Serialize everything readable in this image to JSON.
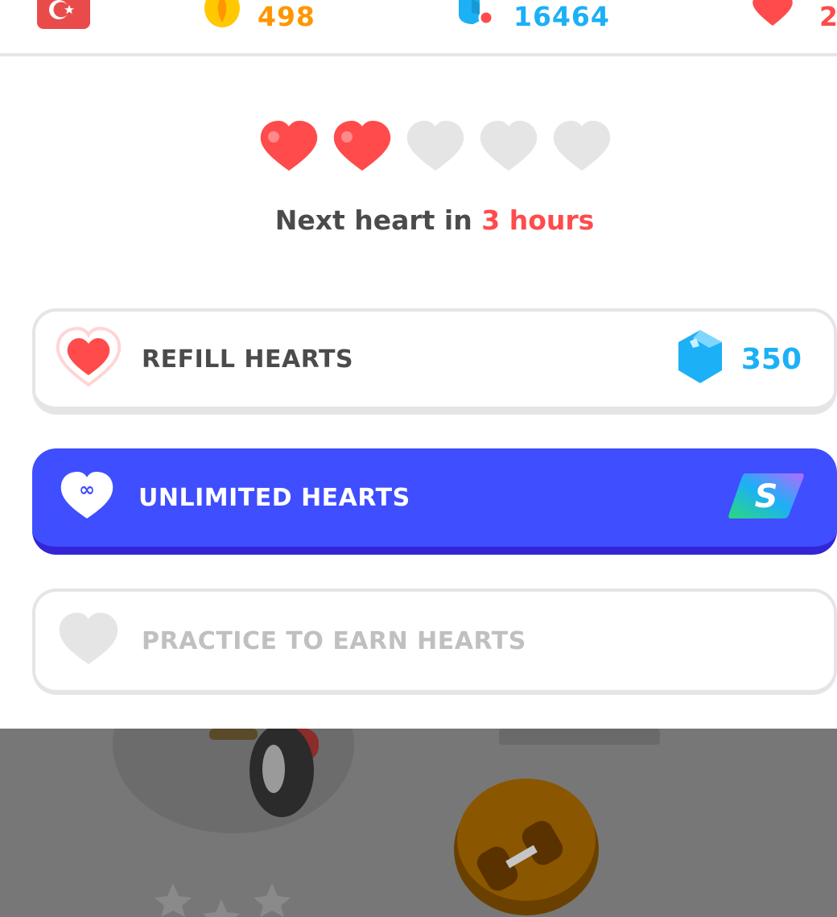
{
  "topbar": {
    "course_flag": "turkish-flag-icon",
    "streak": {
      "icon": "streak-flame-icon",
      "value": "498",
      "color": "#ff9600"
    },
    "gems": {
      "icon": "gem-chest-icon",
      "value": "16464",
      "color": "#1cb0f6"
    },
    "hearts": {
      "icon": "heart-icon",
      "value": "2",
      "color": "#ff4b4b"
    }
  },
  "hearts_panel": {
    "hearts_filled": 2,
    "hearts_total": 5,
    "next_heart": {
      "prefix": "Next heart in",
      "time": "3 hours"
    },
    "options": {
      "refill": {
        "label": "REFILL HEARTS",
        "price": "350",
        "icon": "heart-icon",
        "price_icon": "gem-icon"
      },
      "unlimited": {
        "label": "UNLIMITED HEARTS",
        "icon": "infinity-heart-icon",
        "badge_icon": "super-badge-icon"
      },
      "practice": {
        "label": "PRACTICE TO EARN HEARTS",
        "icon": "heart-outline-icon"
      }
    }
  },
  "colors": {
    "heart_red": "#ff4b4b",
    "heart_empty": "#e5e5e5",
    "gem_blue": "#1cb0f6",
    "unlimited_bg": "#3f4eff",
    "text_dark": "#4b4b4b"
  }
}
